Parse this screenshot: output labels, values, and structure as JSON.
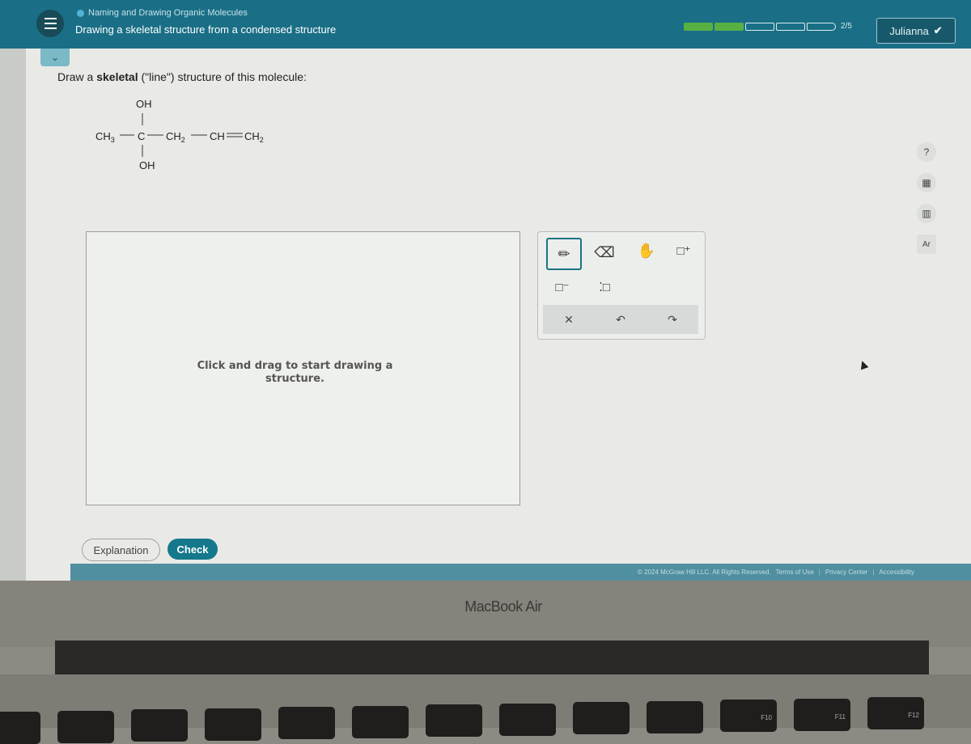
{
  "header": {
    "topic": "Naming and Drawing Organic Molecules",
    "subtitle": "Drawing a skeletal structure from a condensed structure",
    "progress": {
      "completed": 2,
      "total": 5,
      "label": "2/5"
    },
    "user_name": "Julianna",
    "colors": {
      "header": "#1a6f86",
      "progress_done": "#58b043"
    }
  },
  "question": {
    "prompt_before": "Draw a ",
    "prompt_bold": "skeletal",
    "prompt_after": " (\"line\") structure of this molecule:",
    "molecule": {
      "top_group": "OH",
      "bottom_group": "OH",
      "chain": [
        "CH3",
        "C",
        "CH2",
        "CH",
        "CH2"
      ],
      "bonds": [
        "single",
        "single",
        "single",
        "double"
      ]
    }
  },
  "canvas": {
    "hint": "Click and drag to start drawing a structure."
  },
  "toolbox": {
    "tools": [
      {
        "name": "pencil",
        "glyph": "✏",
        "active": true
      },
      {
        "name": "eraser",
        "glyph": "⌫"
      },
      {
        "name": "hand",
        "glyph": "✋"
      },
      {
        "name": "add-charge-positive",
        "glyph": "□⁺"
      },
      {
        "name": "add-charge-negative",
        "glyph": "□⁻"
      },
      {
        "name": "lone-pair",
        "glyph": "⁚□"
      }
    ],
    "actions": [
      {
        "name": "clear",
        "glyph": "✕"
      },
      {
        "name": "undo",
        "glyph": "↶"
      },
      {
        "name": "redo",
        "glyph": "↷"
      }
    ]
  },
  "sidebar": {
    "icons": [
      {
        "name": "help",
        "glyph": "?"
      },
      {
        "name": "calculator",
        "glyph": "▦"
      },
      {
        "name": "data",
        "glyph": "▥"
      },
      {
        "name": "periodic-table",
        "glyph": "Ar"
      }
    ]
  },
  "buttons": {
    "explanation": "Explanation",
    "check": "Check"
  },
  "footer": {
    "copyright": "© 2024 McGraw Hill LLC. All Rights Reserved.",
    "links": [
      "Terms of Use",
      "Privacy Center",
      "Accessibility"
    ]
  },
  "device": {
    "brand": "MacBook Air",
    "keys": [
      "",
      "",
      "",
      "",
      "",
      "",
      "",
      "",
      "",
      "",
      "F10",
      "F11",
      "F12"
    ]
  }
}
